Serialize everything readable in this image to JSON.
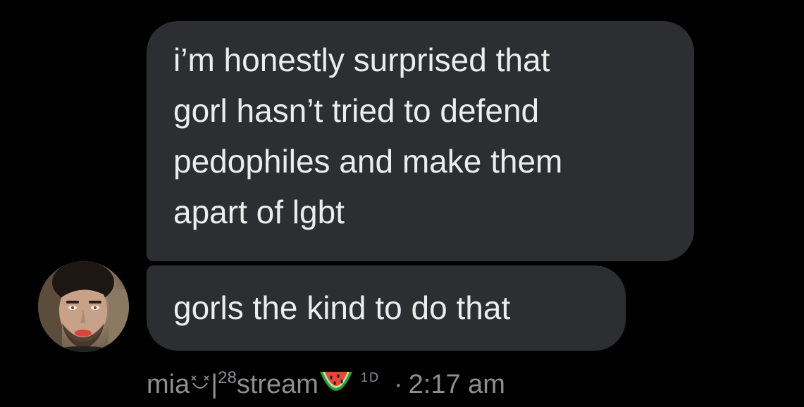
{
  "messages": [
    {
      "lines": [
        "i’m honestly surprised that",
        "gorl hasn’t tried to defend",
        "pedophiles and make them",
        "apart of lgbt"
      ]
    },
    {
      "lines": [
        "gorls the kind to do that"
      ]
    }
  ],
  "sender": {
    "name_prefix": "mia",
    "separator": "|",
    "superscript": "28",
    "name_suffix": "stream",
    "badge": "1D",
    "emoji": "watermelon-icon",
    "avatar_icon": "avatar-photo"
  },
  "timestamp": {
    "dot": "·",
    "time": "2:17 am"
  },
  "colors": {
    "background": "#000000",
    "bubble": "#2c2e31",
    "text": "#ececec",
    "meta": "#8e8e93"
  }
}
